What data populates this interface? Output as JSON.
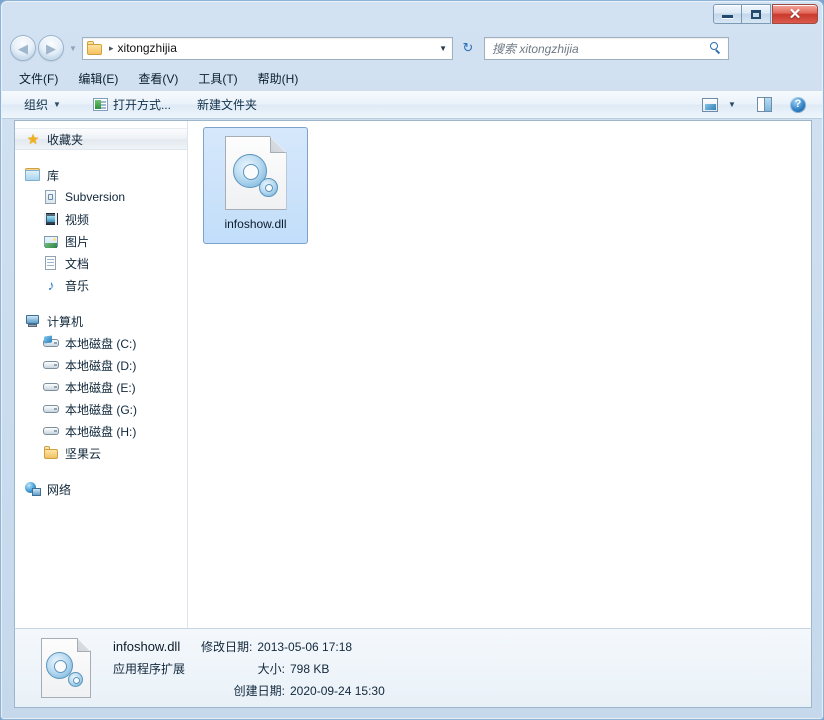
{
  "window": {
    "controls": {
      "minimize": "–",
      "maximize": "□",
      "close": "✕"
    }
  },
  "navigation": {
    "back_arrow": "◀",
    "forward_arrow": "▶",
    "history_caret": "▼",
    "refresh_glyph": "↻"
  },
  "address": {
    "crumb_separator": "▸",
    "path": "xitongzhijia",
    "dropdown_caret": "▼"
  },
  "search": {
    "placeholder": "搜索 xitongzhijia",
    "icon": "search-icon"
  },
  "menu": {
    "items": [
      {
        "label": "文件(F)"
      },
      {
        "label": "编辑(E)"
      },
      {
        "label": "查看(V)"
      },
      {
        "label": "工具(T)"
      },
      {
        "label": "帮助(H)"
      }
    ]
  },
  "toolbar": {
    "organize_label": "组织",
    "organize_caret": "▼",
    "open_with_label": "打开方式...",
    "new_folder_label": "新建文件夹",
    "view_caret": "▼",
    "help_glyph": "?"
  },
  "sidebar": {
    "groups": [
      {
        "header": {
          "label": "收藏夹",
          "icon": "star-icon",
          "selected": true
        },
        "items": []
      },
      {
        "header": {
          "label": "库",
          "icon": "library-icon",
          "selected": false
        },
        "items": [
          {
            "label": "Subversion",
            "icon": "subversion-icon"
          },
          {
            "label": "视频",
            "icon": "video-icon"
          },
          {
            "label": "图片",
            "icon": "pictures-icon"
          },
          {
            "label": "文档",
            "icon": "documents-icon"
          },
          {
            "label": "音乐",
            "icon": "music-icon"
          }
        ]
      },
      {
        "header": {
          "label": "计算机",
          "icon": "computer-icon",
          "selected": false
        },
        "items": [
          {
            "label": "本地磁盘 (C:)",
            "icon": "system-drive-icon"
          },
          {
            "label": "本地磁盘 (D:)",
            "icon": "drive-icon"
          },
          {
            "label": "本地磁盘 (E:)",
            "icon": "drive-icon"
          },
          {
            "label": "本地磁盘 (G:)",
            "icon": "drive-icon"
          },
          {
            "label": "本地磁盘 (H:)",
            "icon": "drive-icon"
          },
          {
            "label": "坚果云",
            "icon": "folder-icon"
          }
        ]
      },
      {
        "header": {
          "label": "网络",
          "icon": "network-icon",
          "selected": false
        },
        "items": []
      }
    ]
  },
  "content": {
    "files": [
      {
        "name": "infoshow.dll",
        "icon": "dll-icon",
        "selected": true
      }
    ]
  },
  "details": {
    "file_name": "infoshow.dll",
    "file_type": "应用程序扩展",
    "modified_label": "修改日期:",
    "modified_value": "2013-05-06 17:18",
    "size_label": "大小:",
    "size_value": "798 KB",
    "created_label": "创建日期:",
    "created_value": "2020-09-24 15:30"
  },
  "colors": {
    "frame": "#cbddef",
    "selection": "#c2defa",
    "selection_border": "#7da2cc",
    "close_button": "#c7392c",
    "accent_blue": "#2b6fb0"
  }
}
